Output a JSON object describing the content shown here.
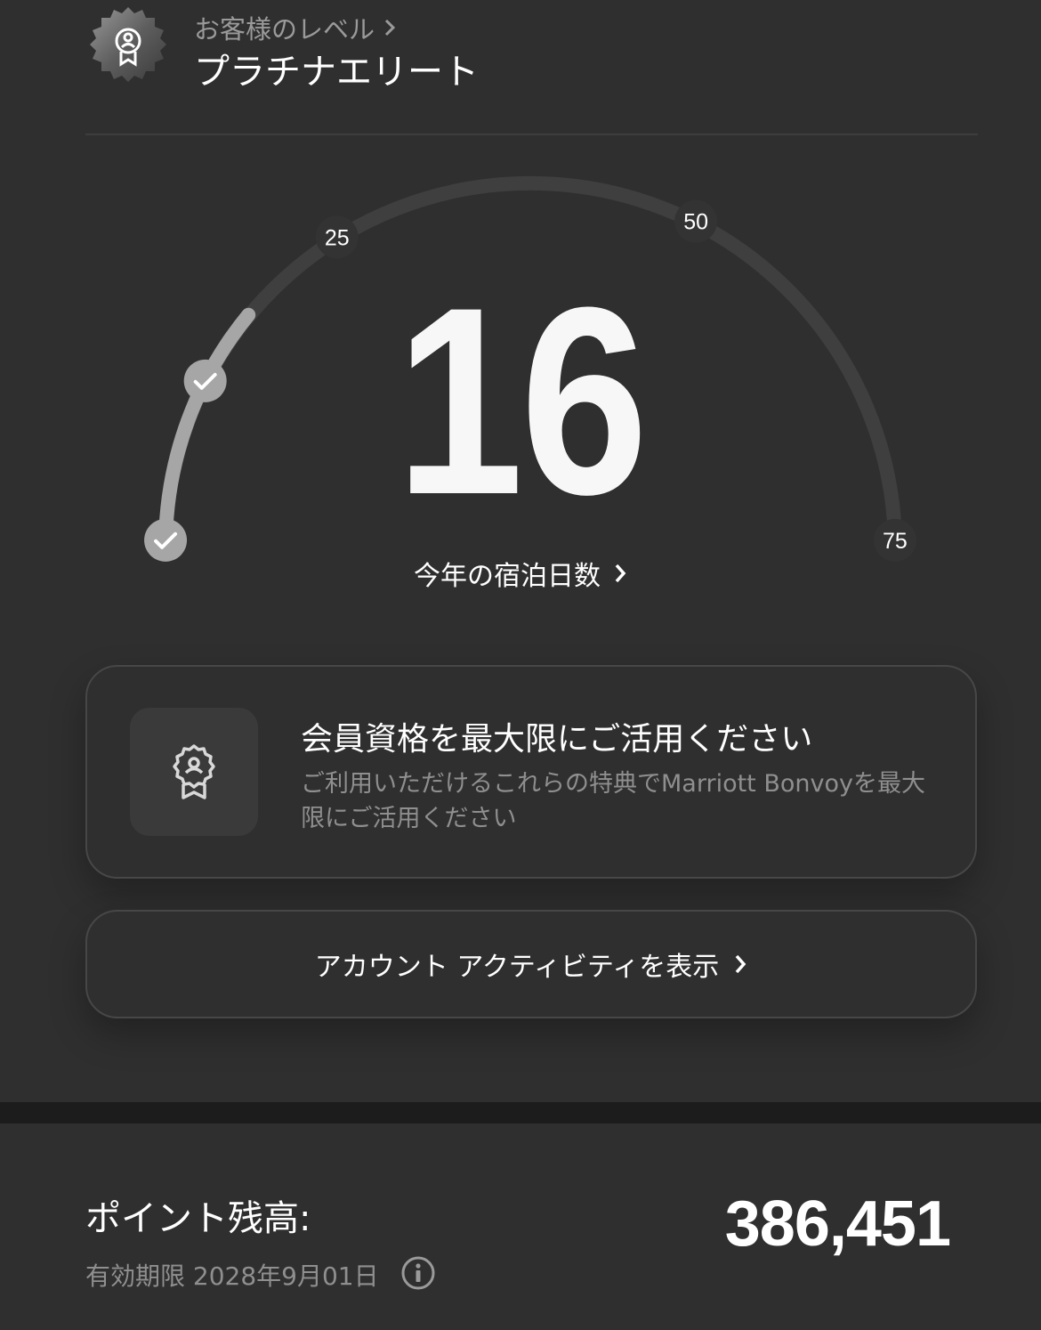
{
  "tier": {
    "label": "お客様のレベル",
    "name": "プラチナエリート"
  },
  "gauge": {
    "nights": "16",
    "nights_value": 16,
    "max": 75,
    "milestones": [
      {
        "value": 0,
        "label": "",
        "achieved": true
      },
      {
        "value": 10,
        "label": "",
        "achieved": true
      },
      {
        "value": 25,
        "label": "25",
        "achieved": false
      },
      {
        "value": 50,
        "label": "50",
        "achieved": false
      },
      {
        "value": 75,
        "label": "75",
        "achieved": false
      }
    ],
    "label": "今年の宿泊日数"
  },
  "benefits": {
    "title": "会員資格を最大限にご活用ください",
    "description": "ご利用いただけるこれらの特典でMarriott Bonvoyを最大限にご活用ください"
  },
  "activity": {
    "label": "アカウント アクティビティを表示"
  },
  "points": {
    "label": "ポイント残高:",
    "value": "386,451",
    "expiry": "有効期限 2028年9月01日"
  },
  "colors": {
    "background": "#2f2f2f",
    "track": "#3f3f3f",
    "progress": "#a6a6a6",
    "muted_text": "#8f8f8f"
  }
}
